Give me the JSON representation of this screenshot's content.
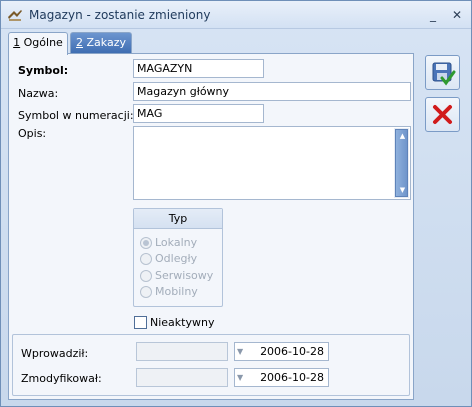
{
  "window": {
    "title": "Magazyn - zostanie zmieniony",
    "minimize_glyph": "_",
    "close_glyph": "✕"
  },
  "tabs": [
    {
      "key": "1",
      "label": " Ogólne",
      "active": true
    },
    {
      "key": "2",
      "label": " Zakazy",
      "active": false
    }
  ],
  "form": {
    "symbol_label": "Symbol:",
    "symbol_value": "MAGAZYN",
    "nazwa_label": "Nazwa:",
    "nazwa_value": "Magazyn główny",
    "symbol_num_label": "Symbol w numeracji:",
    "symbol_num_value": "MAG",
    "opis_label": "Opis:",
    "opis_value": ""
  },
  "typ": {
    "header": "Typ",
    "options": [
      {
        "label": "Lokalny",
        "checked": true
      },
      {
        "label": "Odległy",
        "checked": false
      },
      {
        "label": "Serwisowy",
        "checked": false
      },
      {
        "label": "Mobilny",
        "checked": false
      }
    ]
  },
  "nieaktywny": {
    "label": "Nieaktywny",
    "checked": false
  },
  "audit": {
    "wprowadzil_label": "Wprowadził:",
    "wprowadzil_user": "",
    "wprowadzil_date": "2006-10-28",
    "zmodyfikowal_label": "Zmodyfikował:",
    "zmodyfikowal_user": "",
    "zmodyfikowal_date": "2006-10-28",
    "dropdown_glyph": "▼"
  },
  "icons": {
    "save": "save-icon",
    "cancel": "cancel-icon",
    "accent": "#3d6cb1",
    "cancel_color": "#d11b1b"
  }
}
